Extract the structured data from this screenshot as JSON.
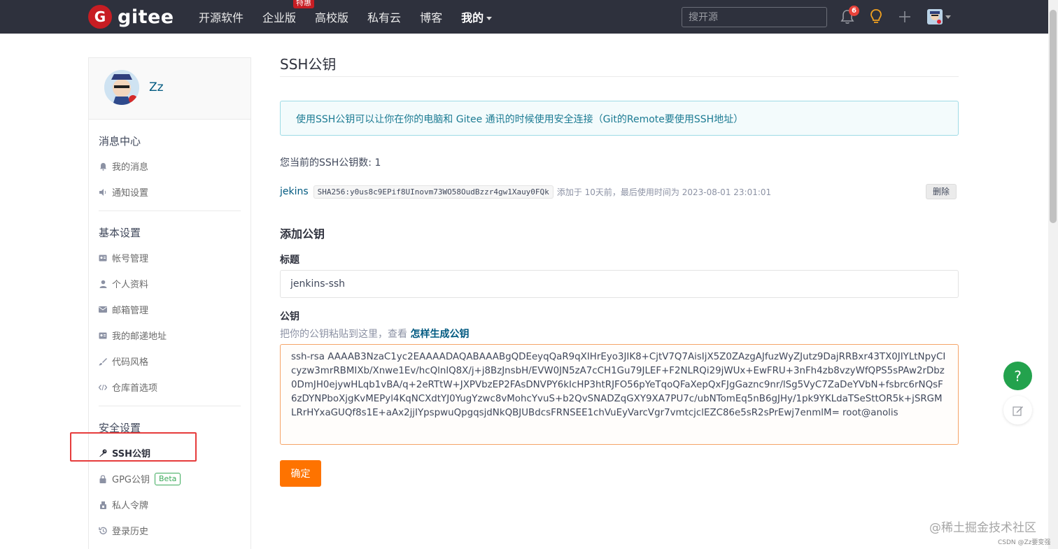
{
  "topnav": {
    "logo_text": "gitee",
    "items": [
      "开源软件",
      "企业版",
      "高校版",
      "私有云",
      "博客",
      "我的"
    ],
    "enterprise_badge": "特惠",
    "search_placeholder": "搜开源",
    "notification_count": "6"
  },
  "sidebar": {
    "username": "Zz",
    "groups": [
      {
        "title": "消息中心",
        "items": [
          "我的消息",
          "通知设置"
        ]
      },
      {
        "title": "基本设置",
        "items": [
          "帐号管理",
          "个人资料",
          "邮箱管理",
          "我的邮递地址",
          "代码风格",
          "仓库首选项"
        ]
      },
      {
        "title": "安全设置",
        "items": [
          "SSH公钥",
          "GPG公钥",
          "私人令牌",
          "登录历史"
        ]
      }
    ],
    "beta_label": "Beta"
  },
  "main": {
    "title": "SSH公钥",
    "info": "使用SSH公钥可以让你在你的电脑和 Gitee 通讯的时候使用安全连接（Git的Remote要使用SSH地址）",
    "count_text": "您当前的SSH公钥数: 1",
    "key": {
      "name": "jekins",
      "fingerprint": "SHA256:y0us8c9EPif8UInovm73WO58OudBzzr4gw1Xauy0FQk",
      "meta": "添加于 10天前，最后使用时间为 2023-08-01 23:01:01",
      "delete_label": "删除"
    },
    "add_title": "添加公钥",
    "title_label": "标题",
    "title_value": "jenkins-ssh",
    "key_label": "公钥",
    "hint_text": "把你的公钥粘贴到这里，查看 ",
    "hint_link": "怎样生成公钥",
    "key_value": "ssh-rsa AAAAB3NzaC1yc2EAAAADAQABAAABgQDEeyqQaR9qXIHrEyo3JIK8+CjtV7Q7AisIjX5Z0ZAzgAJfuzWyZJutz9DajRRBxr43TX0JIYLtNpyCIcyzw3mrRBMIXb/Xnwe1Ev/hcQlnlQ8X/j+j8BzJnsbH/EVW0JN5zA7cCH1Gu79JLEF+F2NLRQi29jWUx+EwFRU+3nFh4zb8vzyWfQPS5sPAw2rDbz0DmJH0ejywHLqb1vBA/q+2eRTtW+JXPVbzEP2FAsDNVPY6kIcHP3htRJFO56pYeTqoQFaXepQxFJgGaznc9nr/lSg5VyC7ZaDeYVbN+fsbrc6rNQsF6zDYNPboXjgKvMEPyl4KqNCXdtYJ0YugYzwc8vMohcYvuS+b2QvSNADZqGXY9XA7PU7c/ubNTomEq5nB6gJHy/1pk9YKLdaTSeSttOR5k+jSRGMLRrHYxaGUQf8s1E+aAx2jjIYpspwuQpgqsjdNkQBJUBdcsFRNSEE1chVuEyVarcVgr7vmtcjclEZC86e5sR2sPrEwj7enmlM= root@anolis",
    "submit_label": "确定"
  },
  "floating": {
    "help_label": "?"
  },
  "watermark": {
    "main": "@稀土掘金技术社区",
    "small": "CSDN @Zz要变强"
  },
  "colors": {
    "brand": "#c71d23",
    "primary_button": "#fe7300",
    "link": "#005980",
    "help_green": "#23a24d"
  }
}
